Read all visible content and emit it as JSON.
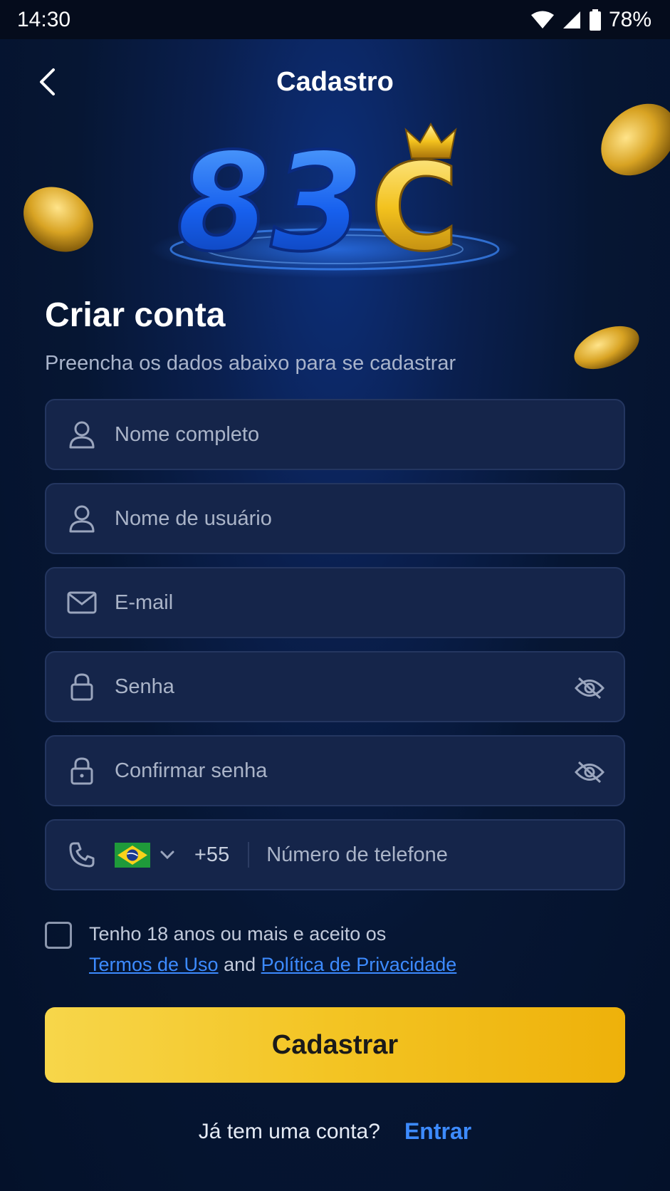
{
  "status_bar": {
    "time": "14:30",
    "battery": "78%"
  },
  "header": {
    "title": "Cadastro"
  },
  "logo": {
    "text": "83",
    "letter": "C"
  },
  "form": {
    "title": "Criar conta",
    "subtitle": "Preencha os dados abaixo para se cadastrar",
    "fields": {
      "full_name": {
        "placeholder": "Nome completo",
        "icon": "user-icon"
      },
      "username": {
        "placeholder": "Nome de usuário",
        "icon": "user-icon"
      },
      "email": {
        "placeholder": "E-mail",
        "icon": "mail-icon"
      },
      "password": {
        "placeholder": "Senha",
        "icon": "lock-icon"
      },
      "confirm_password": {
        "placeholder": "Confirmar senha",
        "icon": "lock-icon"
      },
      "phone": {
        "dial_code": "+55",
        "placeholder": "Número de telefone",
        "icon": "phone-icon",
        "country": "BR"
      }
    },
    "terms": {
      "prefix": "Tenho 18 anos ou mais e aceito os",
      "terms_link": "Termos de Uso",
      "conjunction": "and",
      "privacy_link": "Política de Privacidade",
      "checked": false
    },
    "submit_label": "Cadastrar"
  },
  "footer": {
    "prompt": "Já tem uma conta?",
    "login_link": "Entrar"
  },
  "colors": {
    "accent_yellow": "#f3c423",
    "link_blue": "#3d8bff",
    "field_bg": "#15254a"
  }
}
